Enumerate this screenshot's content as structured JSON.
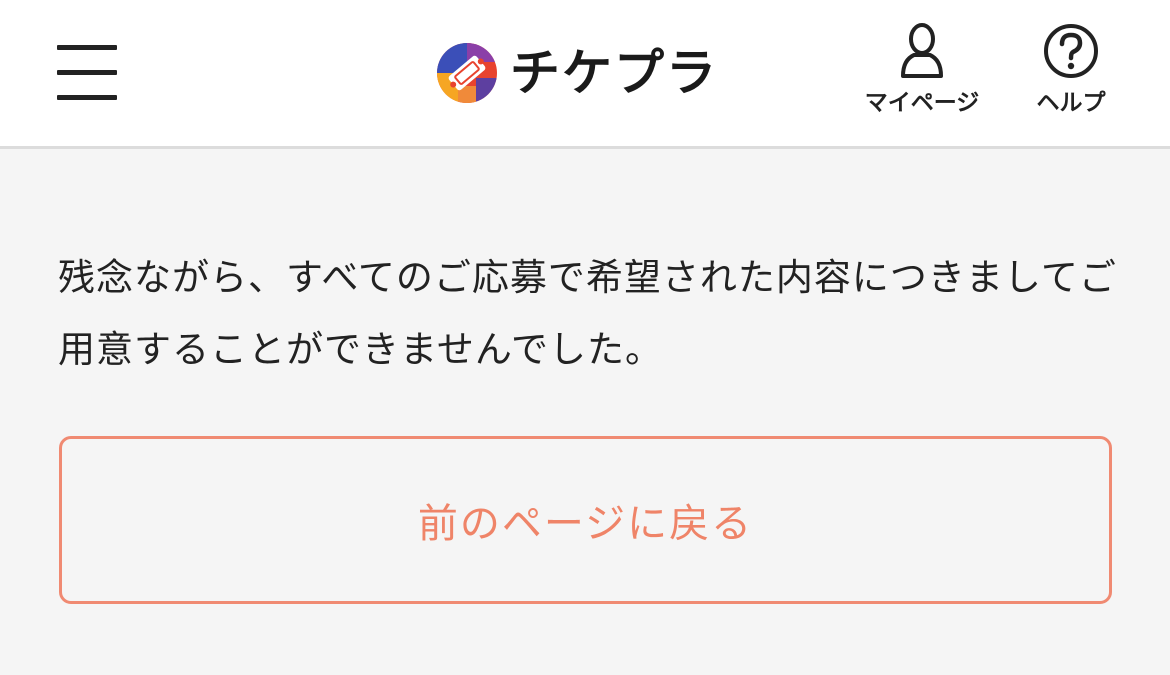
{
  "header": {
    "menu_icon": "hamburger-menu-icon",
    "logo": {
      "text": "チケプラ",
      "icon": "ticket-logo-icon",
      "colors": [
        "#3b4fb8",
        "#e8432e",
        "#f6a623",
        "#8b3fa8"
      ]
    },
    "nav": [
      {
        "label": "マイページ",
        "icon": "user-icon"
      },
      {
        "label": "ヘルプ",
        "icon": "question-circle-icon"
      }
    ]
  },
  "main": {
    "message": "残念ながら、すべてのご応募で希望された内容につきましてご用意することができませんでした。",
    "back_button": {
      "label": "前のページに戻る",
      "color": "#ef8468"
    }
  }
}
